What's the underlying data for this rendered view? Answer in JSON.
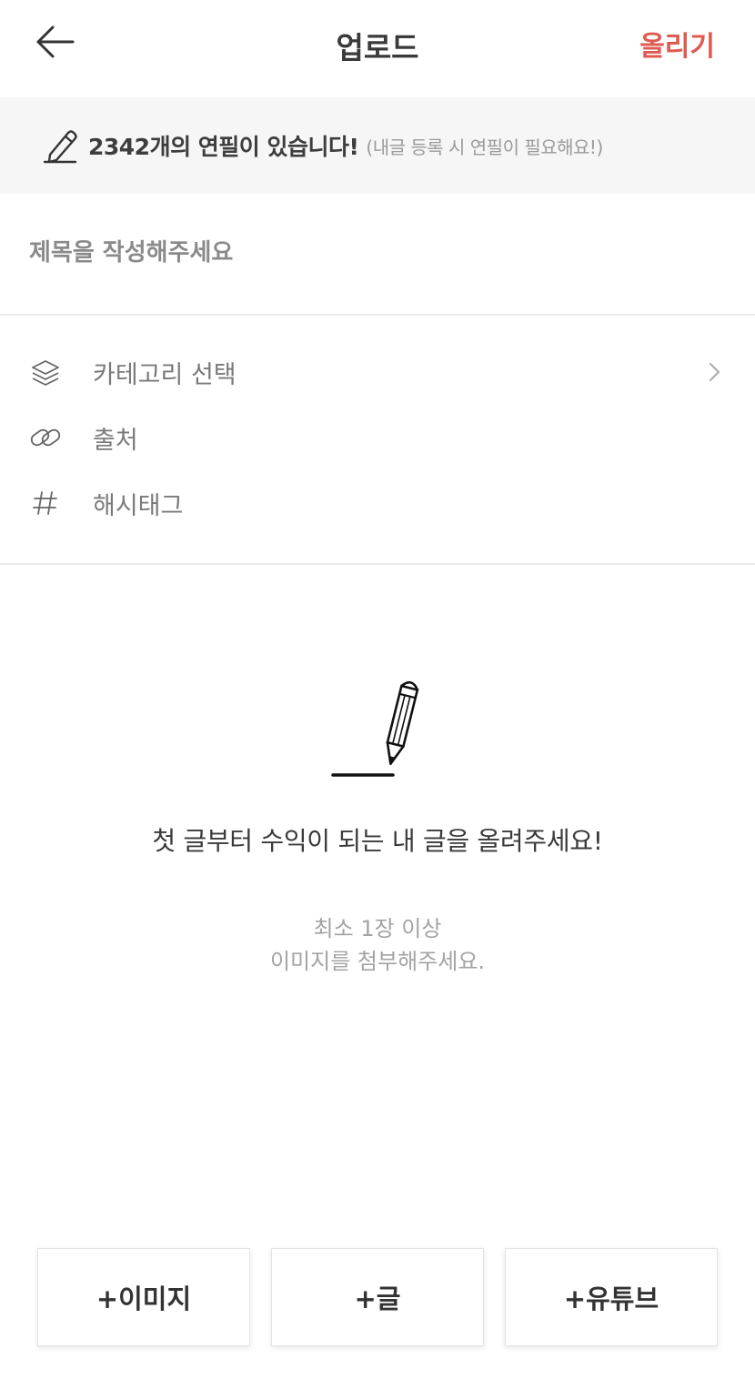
{
  "header": {
    "title": "업로드",
    "action_label": "올리기",
    "back_icon": "arrow-left-icon",
    "accent_color": "#e05a52"
  },
  "pencil_banner": {
    "icon": "pencil-icon",
    "main_text": "2342개의 연필이 있습니다!",
    "note_text": "(내글 등록 시 연필이 필요해요!)"
  },
  "title_field": {
    "placeholder": "제목을 작성해주세요",
    "value": ""
  },
  "options": [
    {
      "icon": "layers-icon",
      "label": "카테고리 선택",
      "has_chevron": true
    },
    {
      "icon": "link-icon",
      "label": "출처",
      "has_chevron": false
    },
    {
      "icon": "hashtag-icon",
      "label": "해시태그",
      "has_chevron": false
    }
  ],
  "empty_state": {
    "illustration": "pencil-writing-icon",
    "main_text": "첫 글부터 수익이 되는 내 글을 올려주세요!",
    "sub_line1": "최소 1장 이상",
    "sub_line2": "이미지를 첨부해주세요."
  },
  "add_buttons": [
    {
      "label": "+이미지"
    },
    {
      "label": "+글"
    },
    {
      "label": "+유튜브"
    }
  ]
}
